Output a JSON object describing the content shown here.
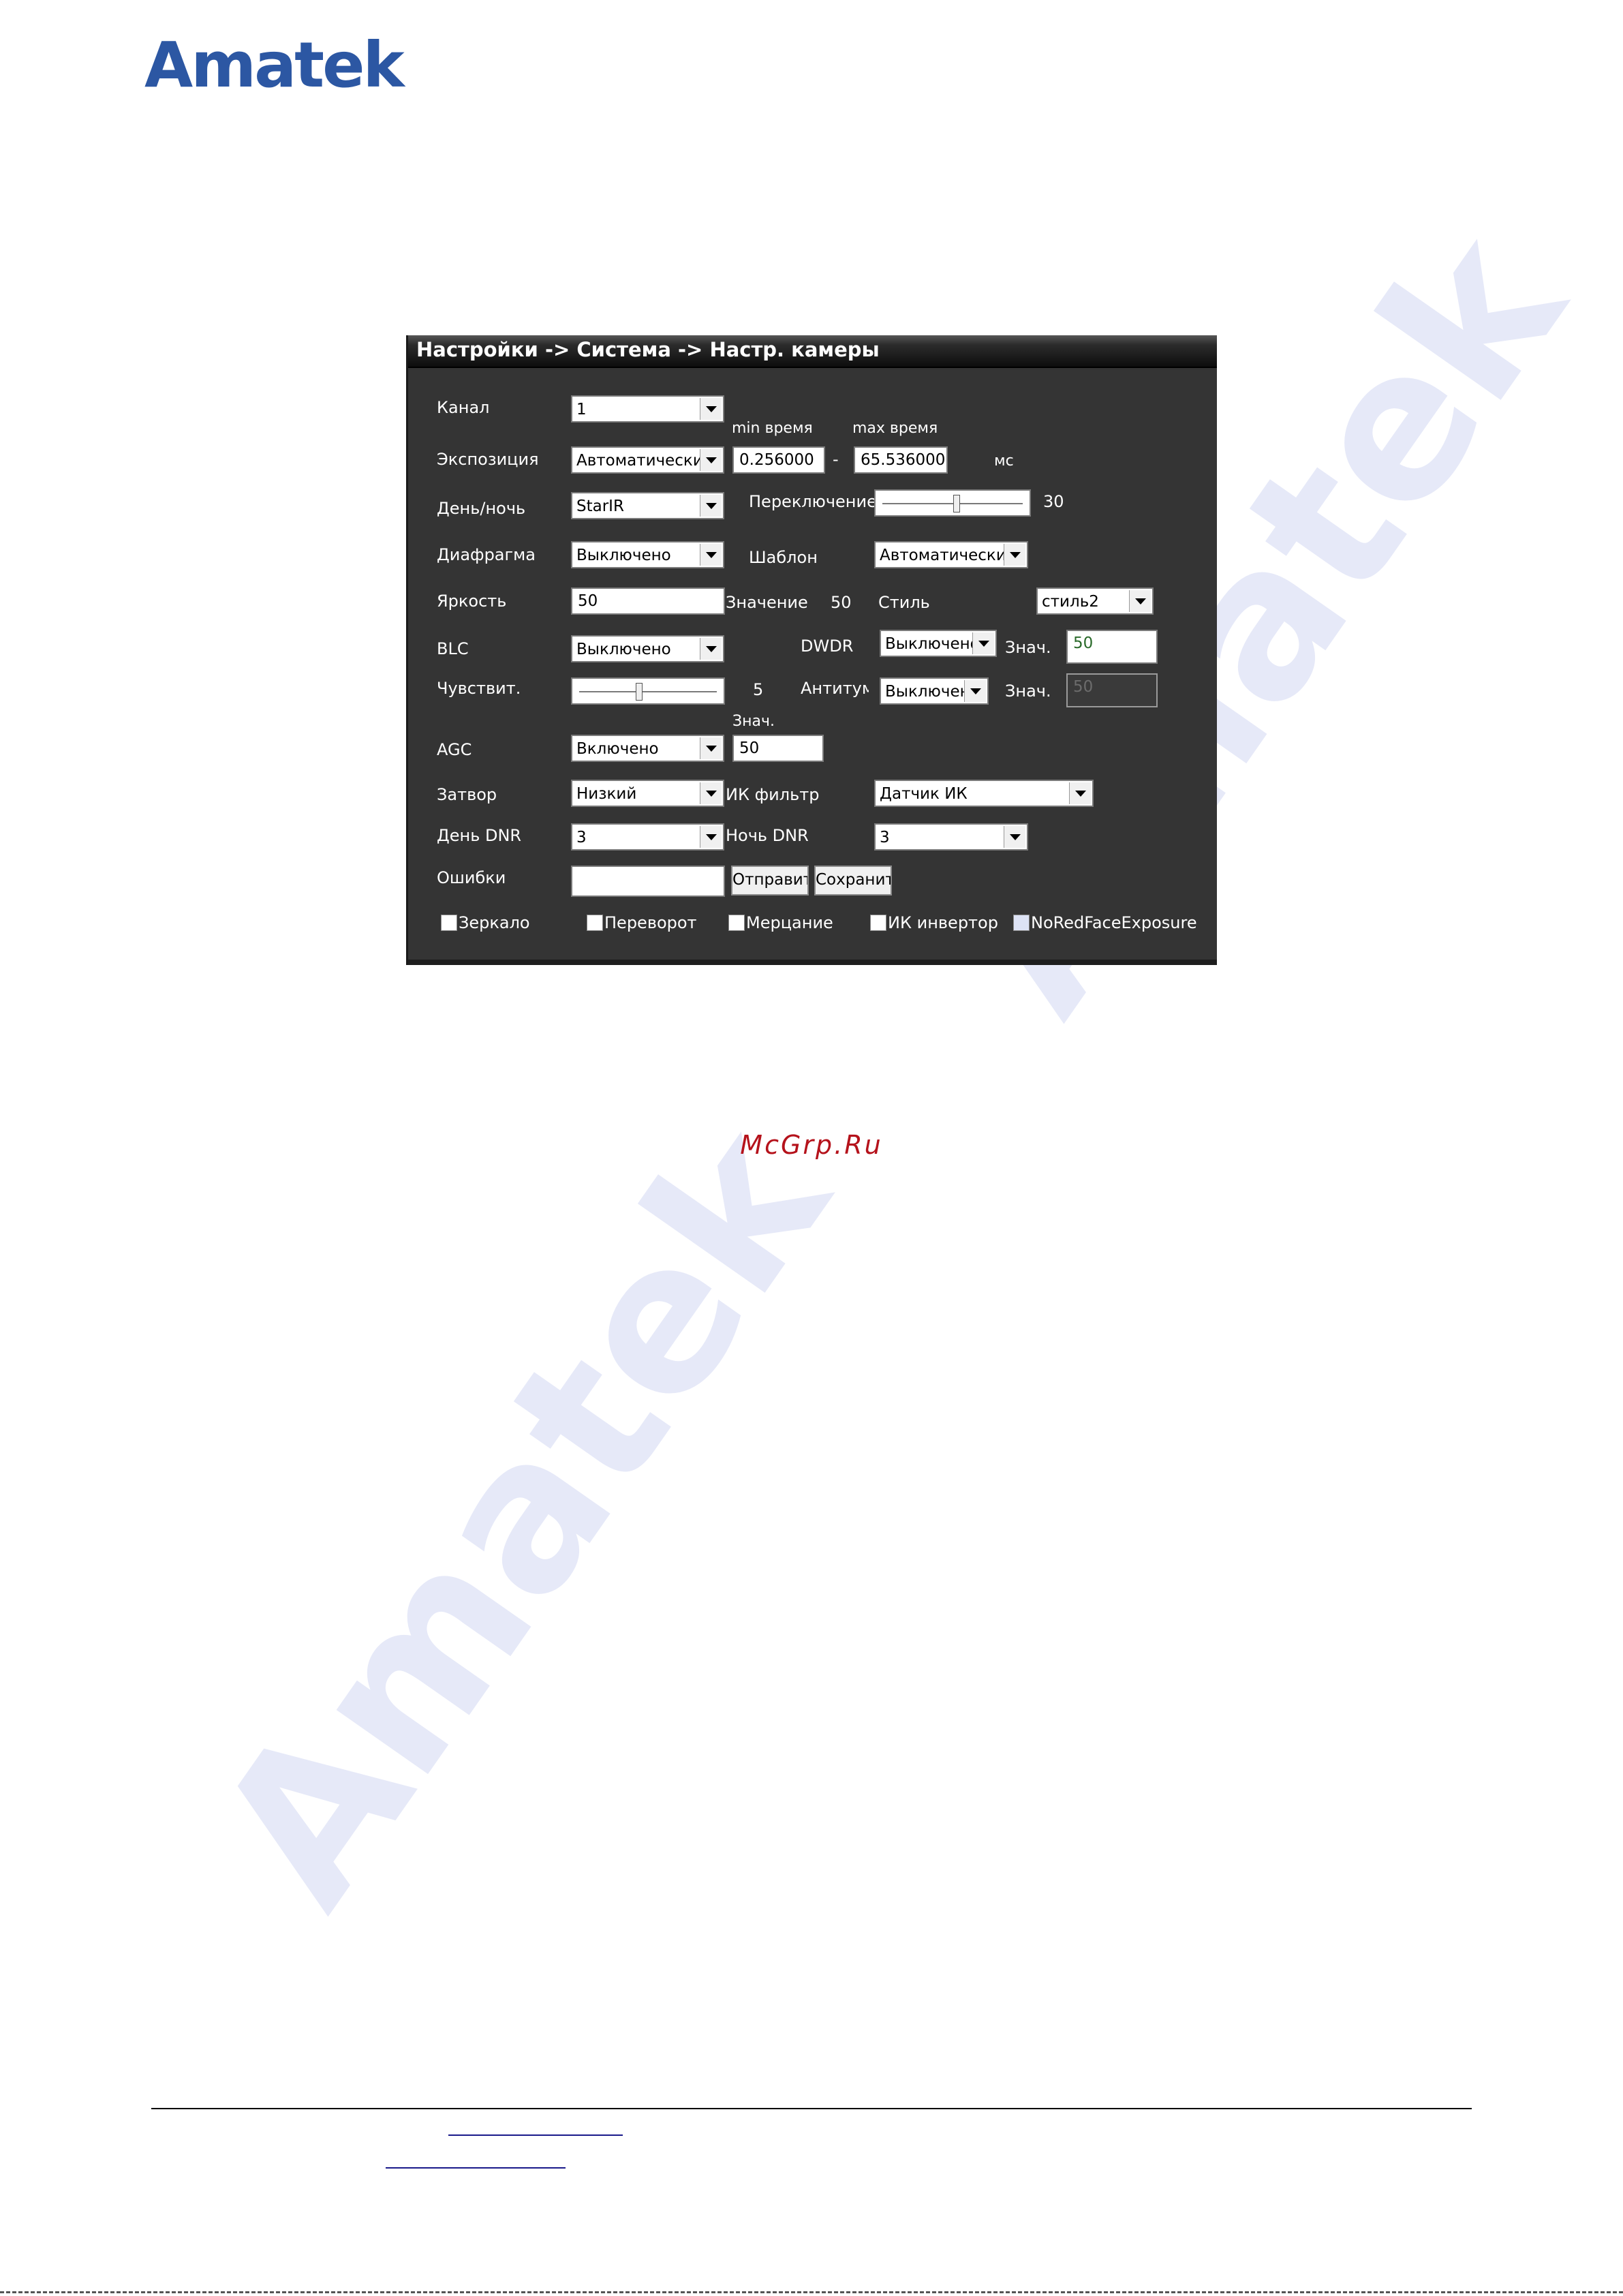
{
  "header": {
    "logo_text": "Amatek"
  },
  "watermark": {
    "text": "Amatek"
  },
  "panel": {
    "title": "Настройки -> Система -> Настр. камеры",
    "labels": {
      "channel": "Канал",
      "exposure": "Экспозиция",
      "min_time": "min время",
      "max_time": "max время",
      "range_dash": "-",
      "ms": "мс",
      "day_night": "День/ночь",
      "switch": "Переключение",
      "switch_value": "30",
      "iris": "Диафрагма",
      "template": "Шаблон",
      "brightness": "Яркость",
      "value": "Значение",
      "value_num": "50",
      "style": "Стиль",
      "blc": "BLC",
      "dwdr": "DWDR",
      "znach1": "Знач.",
      "sensitivity": "Чувствит.",
      "sensitivity_value": "5",
      "antifog": "Антитума",
      "znach2": "Знач.",
      "znach3": "Знач.",
      "agc": "AGC",
      "shutter": "Затвор",
      "ir_filter": "ИК фильтр",
      "day_dnr": "День DNR",
      "night_dnr": "Ночь DNR",
      "errors": "Ошибки"
    },
    "selects": {
      "channel": "1",
      "exposure": "Автоматически",
      "day_night": "StarIR",
      "iris": "Выключено",
      "template": "Автоматически",
      "style": "стиль2",
      "blc": "Выключено",
      "dwdr": "Выключено",
      "antifog": "Выключено",
      "agc": "Включено",
      "shutter": "Низкий",
      "ir_filter": "Датчик ИК",
      "day_dnr": "3",
      "night_dnr": "3"
    },
    "inputs": {
      "min_time": "0.256000",
      "max_time": "65.536000",
      "brightness": "50",
      "dwdr_value": "50",
      "antifog_value": "50",
      "agc_value": "50",
      "errors": ""
    },
    "sliders": {
      "switch_fraction": 0.53,
      "sensitivity_fraction": 0.43
    },
    "buttons": {
      "send": "Отправить",
      "save": "Сохранить"
    },
    "checkboxes": [
      {
        "label": "Зеркало",
        "checked": false
      },
      {
        "label": "Переворот",
        "checked": false
      },
      {
        "label": "Мерцание",
        "checked": false
      },
      {
        "label": "ИК инвертор",
        "checked": false
      },
      {
        "label": "NoRedFaceExposure",
        "checked": false
      }
    ]
  },
  "footer": {
    "site": "McGrp.Ru"
  },
  "colors": {
    "logo": "#2c57a3",
    "panel_bg": "#343434",
    "site": "#b5121b",
    "watermark": "#e6e9f8"
  }
}
